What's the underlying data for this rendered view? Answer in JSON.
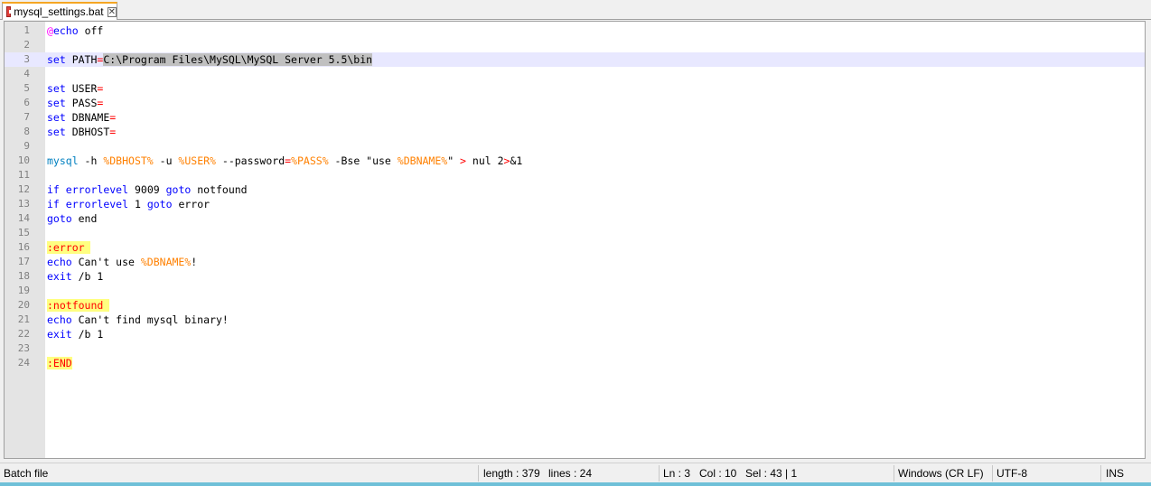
{
  "tab": {
    "filename": "mysql_settings.bat",
    "close_icon": "close-icon"
  },
  "lines": [
    {
      "n": "1",
      "tokens": [
        {
          "t": "@",
          "c": "at"
        },
        {
          "t": "echo",
          "c": "kw"
        },
        {
          "t": " off",
          "c": "plain"
        }
      ]
    },
    {
      "n": "2",
      "tokens": []
    },
    {
      "n": "3",
      "current": true,
      "tokens": [
        {
          "t": "set",
          "c": "kw"
        },
        {
          "t": " PATH",
          "c": "plain"
        },
        {
          "t": "=",
          "c": "op"
        },
        {
          "t": "C:\\Program Files\\MySQL\\MySQL Server 5.5\\bin",
          "c": "sel"
        }
      ]
    },
    {
      "n": "4",
      "tokens": []
    },
    {
      "n": "5",
      "tokens": [
        {
          "t": "set",
          "c": "kw"
        },
        {
          "t": " USER",
          "c": "plain"
        },
        {
          "t": "=",
          "c": "op"
        }
      ]
    },
    {
      "n": "6",
      "tokens": [
        {
          "t": "set",
          "c": "kw"
        },
        {
          "t": " PASS",
          "c": "plain"
        },
        {
          "t": "=",
          "c": "op"
        }
      ]
    },
    {
      "n": "7",
      "tokens": [
        {
          "t": "set",
          "c": "kw"
        },
        {
          "t": " DBNAME",
          "c": "plain"
        },
        {
          "t": "=",
          "c": "op"
        }
      ]
    },
    {
      "n": "8",
      "tokens": [
        {
          "t": "set",
          "c": "kw"
        },
        {
          "t": " DBHOST",
          "c": "plain"
        },
        {
          "t": "=",
          "c": "op"
        }
      ]
    },
    {
      "n": "9",
      "tokens": []
    },
    {
      "n": "10",
      "tokens": [
        {
          "t": "mysql",
          "c": "ext"
        },
        {
          "t": " -h ",
          "c": "plain"
        },
        {
          "t": "%DBHOST%",
          "c": "var"
        },
        {
          "t": " -u ",
          "c": "plain"
        },
        {
          "t": "%USER%",
          "c": "var"
        },
        {
          "t": " --password",
          "c": "plain"
        },
        {
          "t": "=",
          "c": "op"
        },
        {
          "t": "%PASS%",
          "c": "var"
        },
        {
          "t": " -Bse \"use ",
          "c": "plain"
        },
        {
          "t": "%DBNAME%",
          "c": "var"
        },
        {
          "t": "\" ",
          "c": "plain"
        },
        {
          "t": ">",
          "c": "op"
        },
        {
          "t": " nul 2",
          "c": "plain"
        },
        {
          "t": ">",
          "c": "op"
        },
        {
          "t": "&1",
          "c": "plain"
        }
      ]
    },
    {
      "n": "11",
      "tokens": []
    },
    {
      "n": "12",
      "tokens": [
        {
          "t": "if",
          "c": "kw"
        },
        {
          "t": " ",
          "c": "plain"
        },
        {
          "t": "errorlevel",
          "c": "kw"
        },
        {
          "t": " 9009 ",
          "c": "plain"
        },
        {
          "t": "goto",
          "c": "kw"
        },
        {
          "t": " notfound",
          "c": "plain"
        }
      ]
    },
    {
      "n": "13",
      "tokens": [
        {
          "t": "if",
          "c": "kw"
        },
        {
          "t": " ",
          "c": "plain"
        },
        {
          "t": "errorlevel",
          "c": "kw"
        },
        {
          "t": " 1 ",
          "c": "plain"
        },
        {
          "t": "goto",
          "c": "kw"
        },
        {
          "t": " error",
          "c": "plain"
        }
      ]
    },
    {
      "n": "14",
      "tokens": [
        {
          "t": "goto",
          "c": "kw"
        },
        {
          "t": " end",
          "c": "plain"
        }
      ]
    },
    {
      "n": "15",
      "tokens": []
    },
    {
      "n": "16",
      "tokens": [
        {
          "t": ":error ",
          "c": "label"
        }
      ]
    },
    {
      "n": "17",
      "tokens": [
        {
          "t": "echo",
          "c": "kw"
        },
        {
          "t": " Can't use ",
          "c": "plain"
        },
        {
          "t": "%DBNAME%",
          "c": "var"
        },
        {
          "t": "!",
          "c": "plain"
        }
      ]
    },
    {
      "n": "18",
      "tokens": [
        {
          "t": "exit",
          "c": "kw"
        },
        {
          "t": " /b 1",
          "c": "plain"
        }
      ]
    },
    {
      "n": "19",
      "tokens": []
    },
    {
      "n": "20",
      "tokens": [
        {
          "t": ":notfound ",
          "c": "label"
        }
      ]
    },
    {
      "n": "21",
      "tokens": [
        {
          "t": "echo",
          "c": "kw"
        },
        {
          "t": " Can't find mysql binary!",
          "c": "plain"
        }
      ]
    },
    {
      "n": "22",
      "tokens": [
        {
          "t": "exit",
          "c": "kw"
        },
        {
          "t": " /b 1",
          "c": "plain"
        }
      ]
    },
    {
      "n": "23",
      "tokens": []
    },
    {
      "n": "24",
      "tokens": [
        {
          "t": ":END",
          "c": "label"
        }
      ]
    }
  ],
  "status": {
    "language": "Batch file",
    "length": "length : 379",
    "lines": "lines : 24",
    "ln": "Ln : 3",
    "col": "Col : 10",
    "sel": "Sel : 43 | 1",
    "eol": "Windows (CR LF)",
    "encoding": "UTF-8",
    "mode": "INS"
  }
}
